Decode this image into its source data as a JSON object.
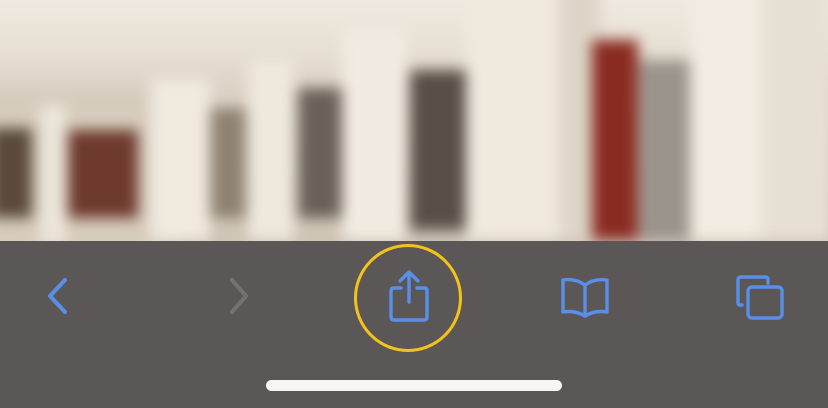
{
  "photo": {
    "subject": "blurred-gallery-photo"
  },
  "toolbar": {
    "background": "#5b5756",
    "accent": "#5a8fe8",
    "disabled": "#757170",
    "buttons": [
      {
        "id": "back",
        "icon": "chevron-left-icon",
        "enabled": true
      },
      {
        "id": "forward",
        "icon": "chevron-right-icon",
        "enabled": false
      },
      {
        "id": "share",
        "icon": "share-icon",
        "enabled": true,
        "highlighted": true
      },
      {
        "id": "bookmarks",
        "icon": "book-icon",
        "enabled": true
      },
      {
        "id": "tabs",
        "icon": "tabs-icon",
        "enabled": true
      }
    ]
  },
  "highlight": {
    "color": "#f2c31b",
    "target": "share"
  }
}
